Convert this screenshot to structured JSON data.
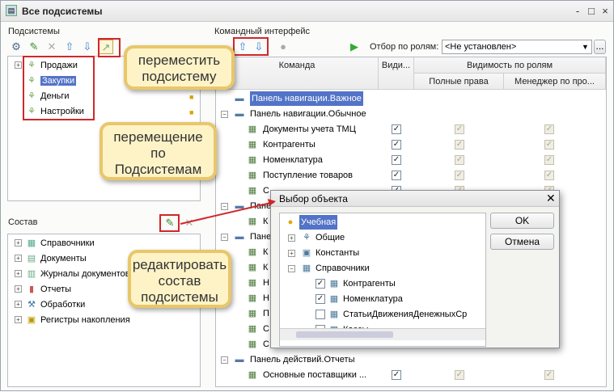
{
  "window": {
    "title": "Все подсистемы",
    "controls": [
      "-",
      "□",
      "×"
    ]
  },
  "left_top": {
    "label": "Подсистемы",
    "items": [
      {
        "label": "Продажи"
      },
      {
        "label": "Закупки"
      },
      {
        "label": "Деньги"
      },
      {
        "label": "Настройки"
      }
    ]
  },
  "left_bottom": {
    "label": "Состав",
    "items": [
      {
        "label": "Справочники"
      },
      {
        "label": "Документы"
      },
      {
        "label": "Журналы документов"
      },
      {
        "label": "Отчеты"
      },
      {
        "label": "Обработки"
      },
      {
        "label": "Регистры накопления"
      }
    ]
  },
  "right": {
    "label": "Командный интерфейс",
    "filter_label": "Отбор по ролям:",
    "filter_value": "<Не установлен>",
    "headers": {
      "command": "Команда",
      "visible": "Види...",
      "roles": "Видимость по ролям",
      "full": "Полные права",
      "manager": "Менеджер по про..."
    },
    "rows": [
      {
        "label": "Панель навигации.Важное",
        "level": 0,
        "group": true,
        "selected": true
      },
      {
        "label": "Панель навигации.Обычное",
        "level": 0,
        "group": true
      },
      {
        "label": "Документы учета ТМЦ",
        "level": 1,
        "checks": [
          true,
          true,
          true
        ]
      },
      {
        "label": "Контрагенты",
        "level": 1,
        "checks": [
          true,
          true,
          true
        ]
      },
      {
        "label": "Номенклатура",
        "level": 1,
        "checks": [
          true,
          true,
          true
        ]
      },
      {
        "label": "Поступление товаров",
        "level": 1,
        "checks": [
          true,
          true,
          true
        ]
      },
      {
        "label": "С",
        "level": 1,
        "checks": [
          true,
          true,
          true
        ]
      },
      {
        "label": "Пане",
        "level": 0,
        "group": true
      },
      {
        "label": "К",
        "level": 1
      },
      {
        "label": "Пане",
        "level": 0,
        "group": true
      },
      {
        "label": "К",
        "level": 1
      },
      {
        "label": "К",
        "level": 1
      },
      {
        "label": "Н",
        "level": 1
      },
      {
        "label": "Н",
        "level": 1
      },
      {
        "label": "П",
        "level": 1
      },
      {
        "label": "С",
        "level": 1
      },
      {
        "label": "С",
        "level": 1
      },
      {
        "label": "Панель действий.Отчеты",
        "level": 0,
        "group": true
      },
      {
        "label": "Основные поставщики ...",
        "level": 1,
        "checks": [
          true,
          true,
          true
        ]
      }
    ]
  },
  "dialog": {
    "title": "Выбор объекта",
    "ok": "OK",
    "cancel": "Отмена",
    "items": [
      {
        "label": "Учебная",
        "level": 0
      },
      {
        "label": "Общие",
        "level": 1
      },
      {
        "label": "Константы",
        "level": 1
      },
      {
        "label": "Справочники",
        "level": 1
      },
      {
        "label": "Контрагенты",
        "level": 2,
        "checked": true
      },
      {
        "label": "Номенклатура",
        "level": 2,
        "checked": true
      },
      {
        "label": "СтатьиДвиженияДенежныхСр",
        "level": 2,
        "checked": false
      },
      {
        "label": "Кассы",
        "level": 2,
        "checked": false
      }
    ]
  },
  "callouts": {
    "move": "переместить подсистему",
    "move_between": "перемещение по Подсистемам",
    "edit": "редактировать состав подсистемы"
  },
  "colors": {
    "accent_red": "#d0272a",
    "callout_bg": "#fef3c7",
    "callout_border": "#e8c76a",
    "selection": "#5273c7"
  }
}
